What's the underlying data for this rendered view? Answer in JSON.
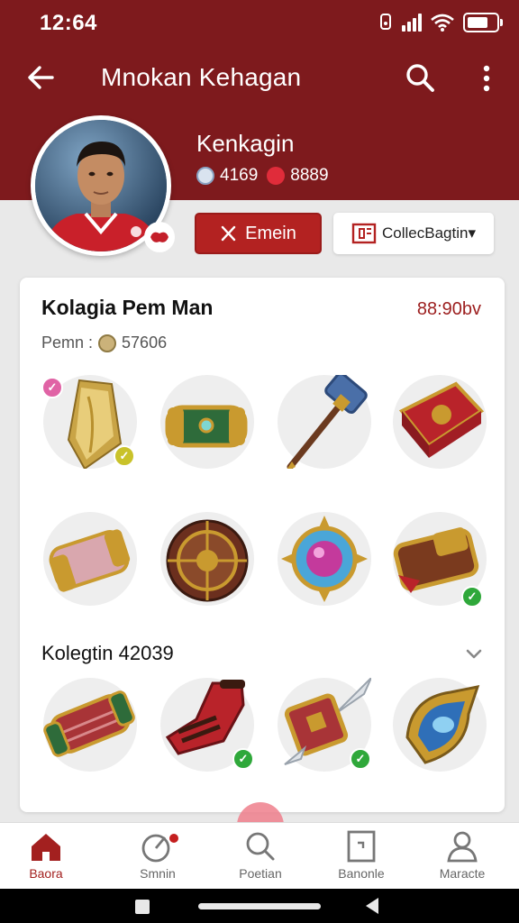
{
  "status_bar": {
    "time": "12:64"
  },
  "header": {
    "title": "Mnokan Kehagan"
  },
  "profile": {
    "name": "Kenkagin",
    "stat_a": "4169",
    "stat_b": "8889",
    "follow_label": "Emein",
    "collection_label": "CollecBagtin▾"
  },
  "collection": {
    "title": "Kolagia Pem Man",
    "value": "88:90bv",
    "points_label": "Pemn :",
    "points_value": "57606",
    "section_title": "Kolegtin 42039"
  },
  "items": [
    {
      "name": "golden-cloak",
      "row": 1
    },
    {
      "name": "green-bracer",
      "row": 1
    },
    {
      "name": "war-hammer",
      "row": 1
    },
    {
      "name": "red-tome",
      "row": 1
    },
    {
      "name": "pink-bracer",
      "row": 2
    },
    {
      "name": "round-shield",
      "row": 2
    },
    {
      "name": "gem-amulet",
      "row": 2
    },
    {
      "name": "treasure-gauntlet",
      "row": 2
    },
    {
      "name": "red-scroll-bracer",
      "row": 3
    },
    {
      "name": "red-boot",
      "row": 3
    },
    {
      "name": "armored-sword",
      "row": 3
    },
    {
      "name": "blue-gem-pauldron",
      "row": 3
    }
  ],
  "bottom_nav": [
    {
      "label": "Baora",
      "icon": "home-icon",
      "active": true
    },
    {
      "label": "Smnin",
      "icon": "activity-icon",
      "active": false
    },
    {
      "label": "Poetian",
      "icon": "search-icon",
      "active": false
    },
    {
      "label": "Banonle",
      "icon": "document-icon",
      "active": false
    },
    {
      "label": "Maracte",
      "icon": "profile-icon",
      "active": false
    }
  ],
  "colors": {
    "header": "#7e1a1d",
    "accent": "#b32221",
    "badge_green": "#2fa83a",
    "badge_yellow": "#c9c22a"
  }
}
